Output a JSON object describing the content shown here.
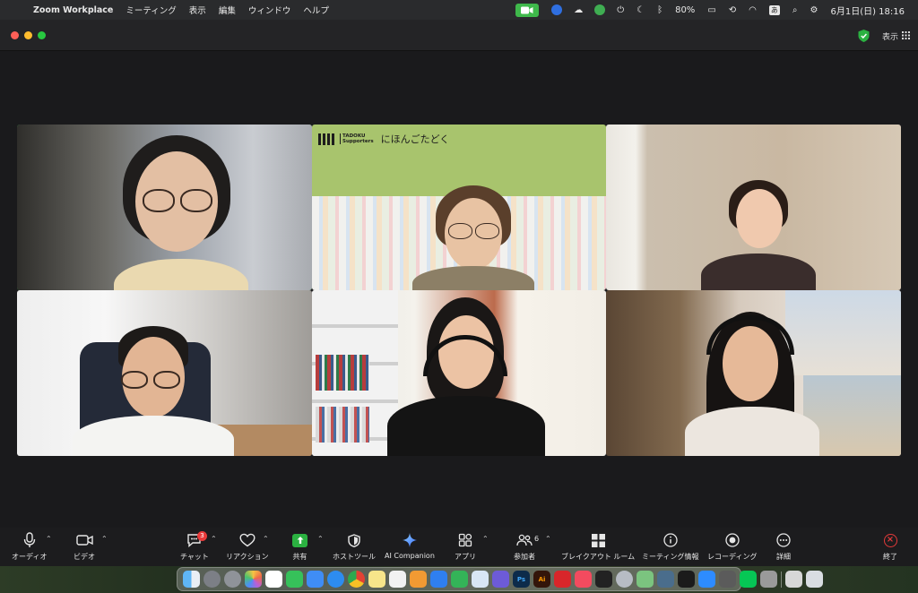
{
  "menubar": {
    "apple": "",
    "app_name": "Zoom Workplace",
    "menus": [
      "ミーティング",
      "表示",
      "編集",
      "ウィンドウ",
      "ヘルプ"
    ],
    "battery": "80%",
    "ime": "あ",
    "clock": "6月1日(日)  18:16"
  },
  "window": {
    "view_label": "表示"
  },
  "tiles": {
    "banner_brand_line1": "TADOKU",
    "banner_brand_line2": "Supporters",
    "banner_title": "にほんごたどく"
  },
  "toolbar": {
    "audio": "オーディオ",
    "video": "ビデオ",
    "chat": "チャット",
    "chat_badge": "3",
    "reactions": "リアクション",
    "share": "共有",
    "host_tools": "ホストツール",
    "ai_companion": "AI Companion",
    "apps": "アプリ",
    "participants": "参加者",
    "participants_count": "6",
    "breakout": "ブレイクアウト ルーム",
    "meeting_info": "ミーティング情報",
    "recording": "レコーディング",
    "more": "詳細",
    "end": "終了"
  },
  "colors": {
    "menubar_bg": "#2a2b2d",
    "window_bg": "#1c1c1e",
    "active_speaker": "#29c23f",
    "share_green": "#2bb141",
    "end_red": "#e33a3a",
    "badge_red": "#e83a3a",
    "banner_green": "#a8c46d"
  },
  "icons": {
    "audio": "microphone-icon",
    "video": "camera-icon",
    "chat": "chat-bubble-icon",
    "reactions": "heart-icon",
    "share": "share-arrow-icon",
    "host_tools": "shield-icon",
    "ai_companion": "sparkle-icon",
    "apps": "apps-icon",
    "participants": "people-icon",
    "breakout": "grid-icon",
    "meeting_info": "info-icon",
    "recording": "record-icon",
    "more": "ellipsis-icon",
    "end": "close-icon"
  }
}
